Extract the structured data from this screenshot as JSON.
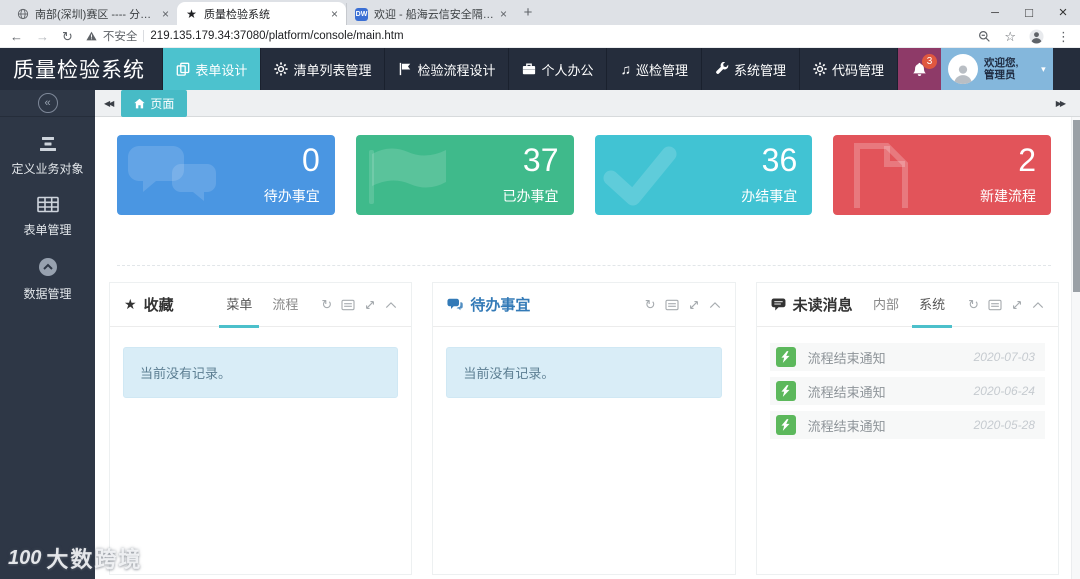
{
  "browser": {
    "tabs": [
      {
        "title": "南部(深圳)赛区 ---- 分区赛",
        "icon": "globe-icon",
        "active": false
      },
      {
        "title": "质量检验系统",
        "icon": "star-favicon",
        "active": true
      },
      {
        "title": "欢迎 - 船海云信安全隔离与信息...",
        "icon": "app-favicon",
        "active": false
      }
    ],
    "security_label": "不安全",
    "url": "219.135.179.34:37080/platform/console/main.htm",
    "favicon_app_text": "DW"
  },
  "icons": {
    "back": "←",
    "forward": "→",
    "reload": "↻",
    "bookmark_star": "☆",
    "menu_dots": "⋮",
    "minimize": "─",
    "maximize": "□",
    "close": "×",
    "tab_close": "×",
    "new_tab": "+",
    "scroll_tabs_left": "◀◀",
    "scroll_tabs_right": "▶▶",
    "sidebar_collapse": "«",
    "caret_down": "▾",
    "panel_refresh": "↻",
    "music_notes": "♫",
    "star_solid": "★"
  },
  "header": {
    "title": "质量检验系统",
    "menu": [
      {
        "icon": "copy-icon",
        "label": "表单设计",
        "active": true
      },
      {
        "icon": "gear-icon",
        "label": "清单列表管理",
        "active": false
      },
      {
        "icon": "flag-icon",
        "label": "检验流程设计",
        "active": false
      },
      {
        "icon": "briefcase-icon",
        "label": "个人办公",
        "active": false
      },
      {
        "icon": "music-notes-icon",
        "label": "巡检管理",
        "active": false
      },
      {
        "icon": "wrench-icon",
        "label": "系统管理",
        "active": false
      },
      {
        "icon": "gear-icon",
        "label": "代码管理",
        "active": false
      }
    ],
    "notification_count": "3",
    "user_greeting": "欢迎您,",
    "user_name": "管理员"
  },
  "sidebar": {
    "items": [
      {
        "icon": "sliders-icon",
        "label": "定义业务对象"
      },
      {
        "icon": "table-icon",
        "label": "表单管理"
      },
      {
        "icon": "circle-up-icon",
        "label": "数据管理"
      }
    ]
  },
  "tabbar": {
    "page_tab_label": "页面"
  },
  "cards": [
    {
      "value": "0",
      "label": "待办事宜",
      "color": "#4a96e2",
      "watermark": "comments-icon"
    },
    {
      "value": "37",
      "label": "已办事宜",
      "color": "#3fba8b",
      "watermark": "flag-icon"
    },
    {
      "value": "36",
      "label": "办结事宜",
      "color": "#41c3d3",
      "watermark": "check-icon"
    },
    {
      "value": "2",
      "label": "新建流程",
      "color": "#e2545a",
      "watermark": "file-icon"
    }
  ],
  "panels": {
    "favorites": {
      "title": "收藏",
      "tabs": [
        {
          "label": "菜单",
          "active": true
        },
        {
          "label": "流程",
          "active": false
        }
      ],
      "empty_text": "当前没有记录。"
    },
    "todo": {
      "title": "待办事宜",
      "empty_text": "当前没有记录。"
    },
    "messages": {
      "title": "未读消息",
      "tabs": [
        {
          "label": "内部",
          "active": false
        },
        {
          "label": "系统",
          "active": true
        }
      ],
      "items": [
        {
          "text": "流程结束通知",
          "date": "2020-07-03"
        },
        {
          "text": "流程结束通知",
          "date": "2020-06-24"
        },
        {
          "text": "流程结束通知",
          "date": "2020-05-28"
        }
      ]
    }
  },
  "watermark": {
    "logo": "100",
    "text": "大数跨境"
  },
  "colors": {
    "accent_teal": "#4cc2ce",
    "header_bg": "#252d3c",
    "sidebar_bg": "#2e3746",
    "bell_bg": "#8e3a68",
    "user_bg": "#84b7dc",
    "badge": "#e0573f",
    "card_blue": "#4a96e2",
    "card_green": "#3fba8b",
    "card_cyan": "#41c3d3",
    "card_red": "#e2545a",
    "message_icon_green": "#5cb85c"
  }
}
